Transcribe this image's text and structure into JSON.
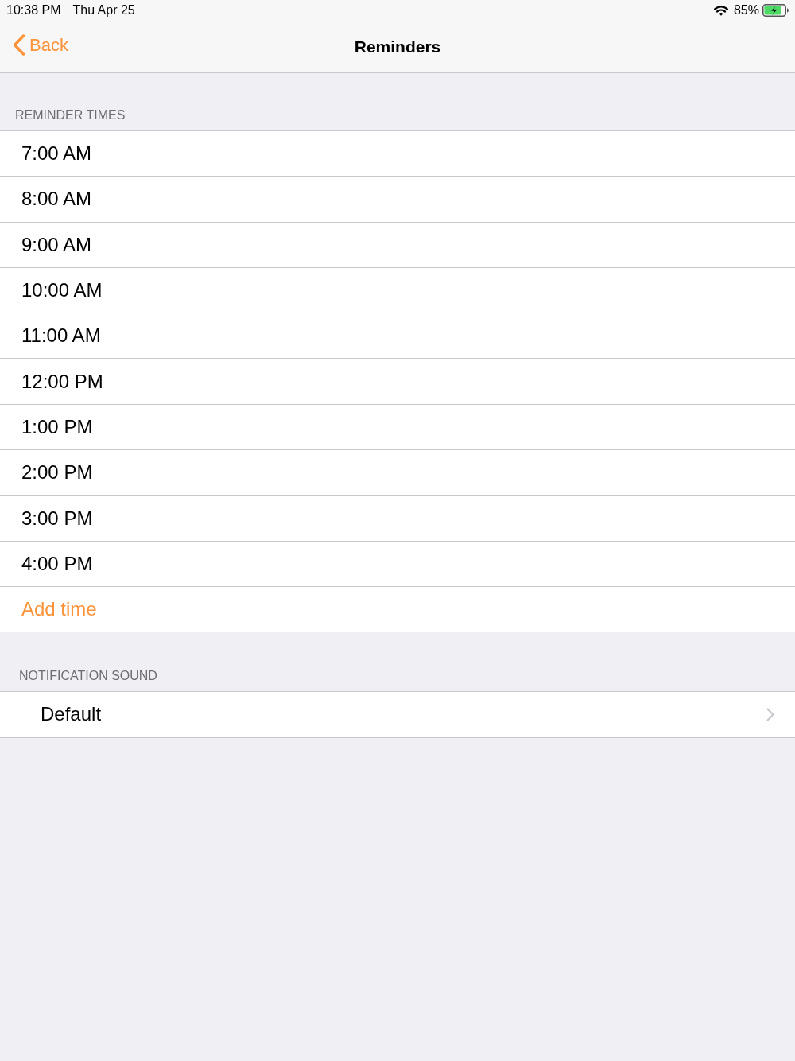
{
  "status_bar": {
    "time": "10:38 PM",
    "date": "Thu Apr 25",
    "battery_percent": "85%"
  },
  "nav_bar": {
    "back": "Back",
    "title": "Reminders"
  },
  "sections": [
    {
      "header": "REMINDER TIMES",
      "rows": [
        {
          "kind": "time",
          "label": "7:00 AM"
        },
        {
          "kind": "time",
          "label": "8:00 AM"
        },
        {
          "kind": "time",
          "label": "9:00 AM"
        },
        {
          "kind": "time",
          "label": "10:00 AM"
        },
        {
          "kind": "time",
          "label": "11:00 AM"
        },
        {
          "kind": "time",
          "label": "12:00 PM"
        },
        {
          "kind": "time",
          "label": "1:00 PM"
        },
        {
          "kind": "time",
          "label": "2:00 PM"
        },
        {
          "kind": "time",
          "label": "3:00 PM"
        },
        {
          "kind": "time",
          "label": "4:00 PM"
        },
        {
          "kind": "action",
          "label": "Add time"
        }
      ]
    },
    {
      "header": "NOTIFICATION SOUND",
      "rows": [
        {
          "kind": "disclosure",
          "label": "Default"
        }
      ]
    }
  ]
}
